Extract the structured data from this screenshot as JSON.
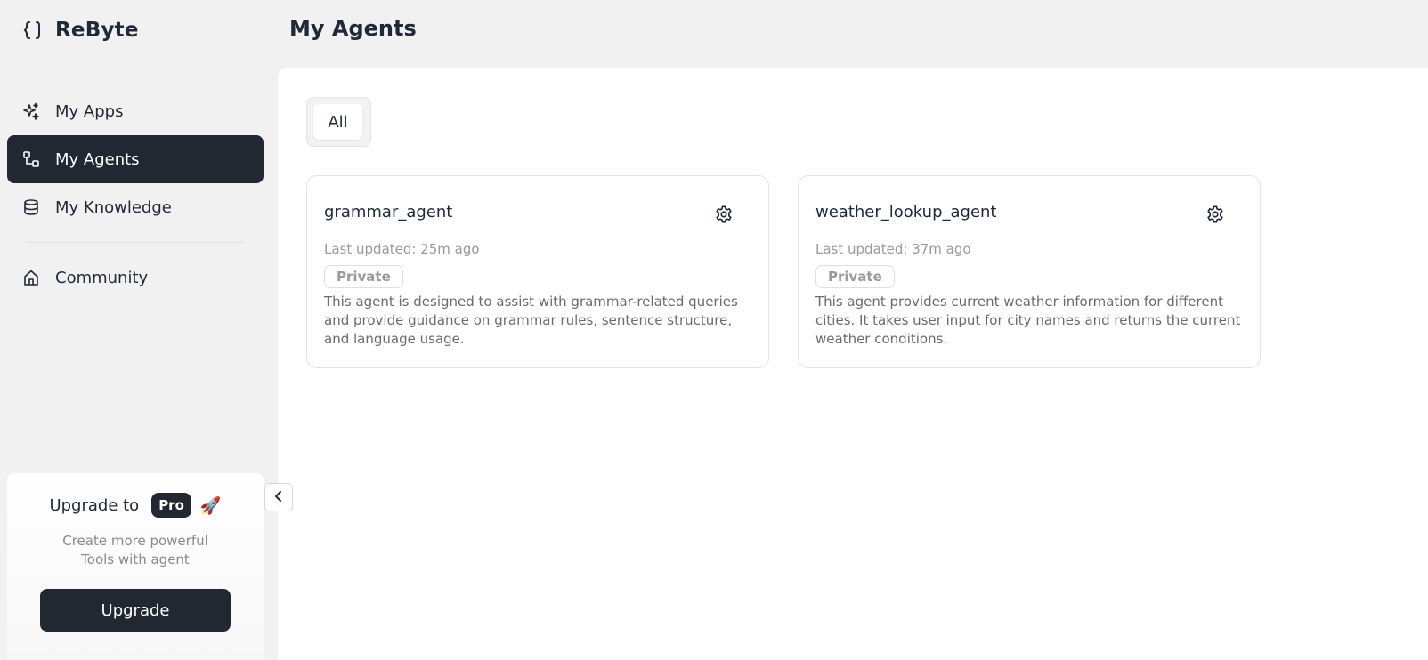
{
  "app": {
    "name": "ReByte"
  },
  "sidebar": {
    "items": [
      {
        "label": "My Apps",
        "icon": "sparkles-icon"
      },
      {
        "label": "My Agents",
        "icon": "flow-icon",
        "active": true
      },
      {
        "label": "My Knowledge",
        "icon": "database-icon"
      },
      {
        "label": "Community",
        "icon": "home-icon"
      }
    ],
    "upgrade": {
      "title": "Upgrade to",
      "badge": "Pro",
      "emoji": "🚀",
      "description_line1": "Create more powerful",
      "description_line2": "Tools with agent",
      "button": "Upgrade"
    }
  },
  "header": {
    "title": "My Agents"
  },
  "filters": {
    "tabs": [
      "All"
    ]
  },
  "agents": [
    {
      "name": "grammar_agent",
      "updated": "Last updated: 25m ago",
      "visibility": "Private",
      "description": "This agent is designed to assist with grammar-related queries and provide guidance on grammar rules, sentence structure, and language usage."
    },
    {
      "name": "weather_lookup_agent",
      "updated": "Last updated: 37m ago",
      "visibility": "Private",
      "description": "This agent provides current weather information for different cities. It takes user input for city names and returns the current weather conditions."
    }
  ],
  "colors": {
    "active_nav": "#222831",
    "background": "#f1f1f1",
    "panel": "#ffffff"
  }
}
